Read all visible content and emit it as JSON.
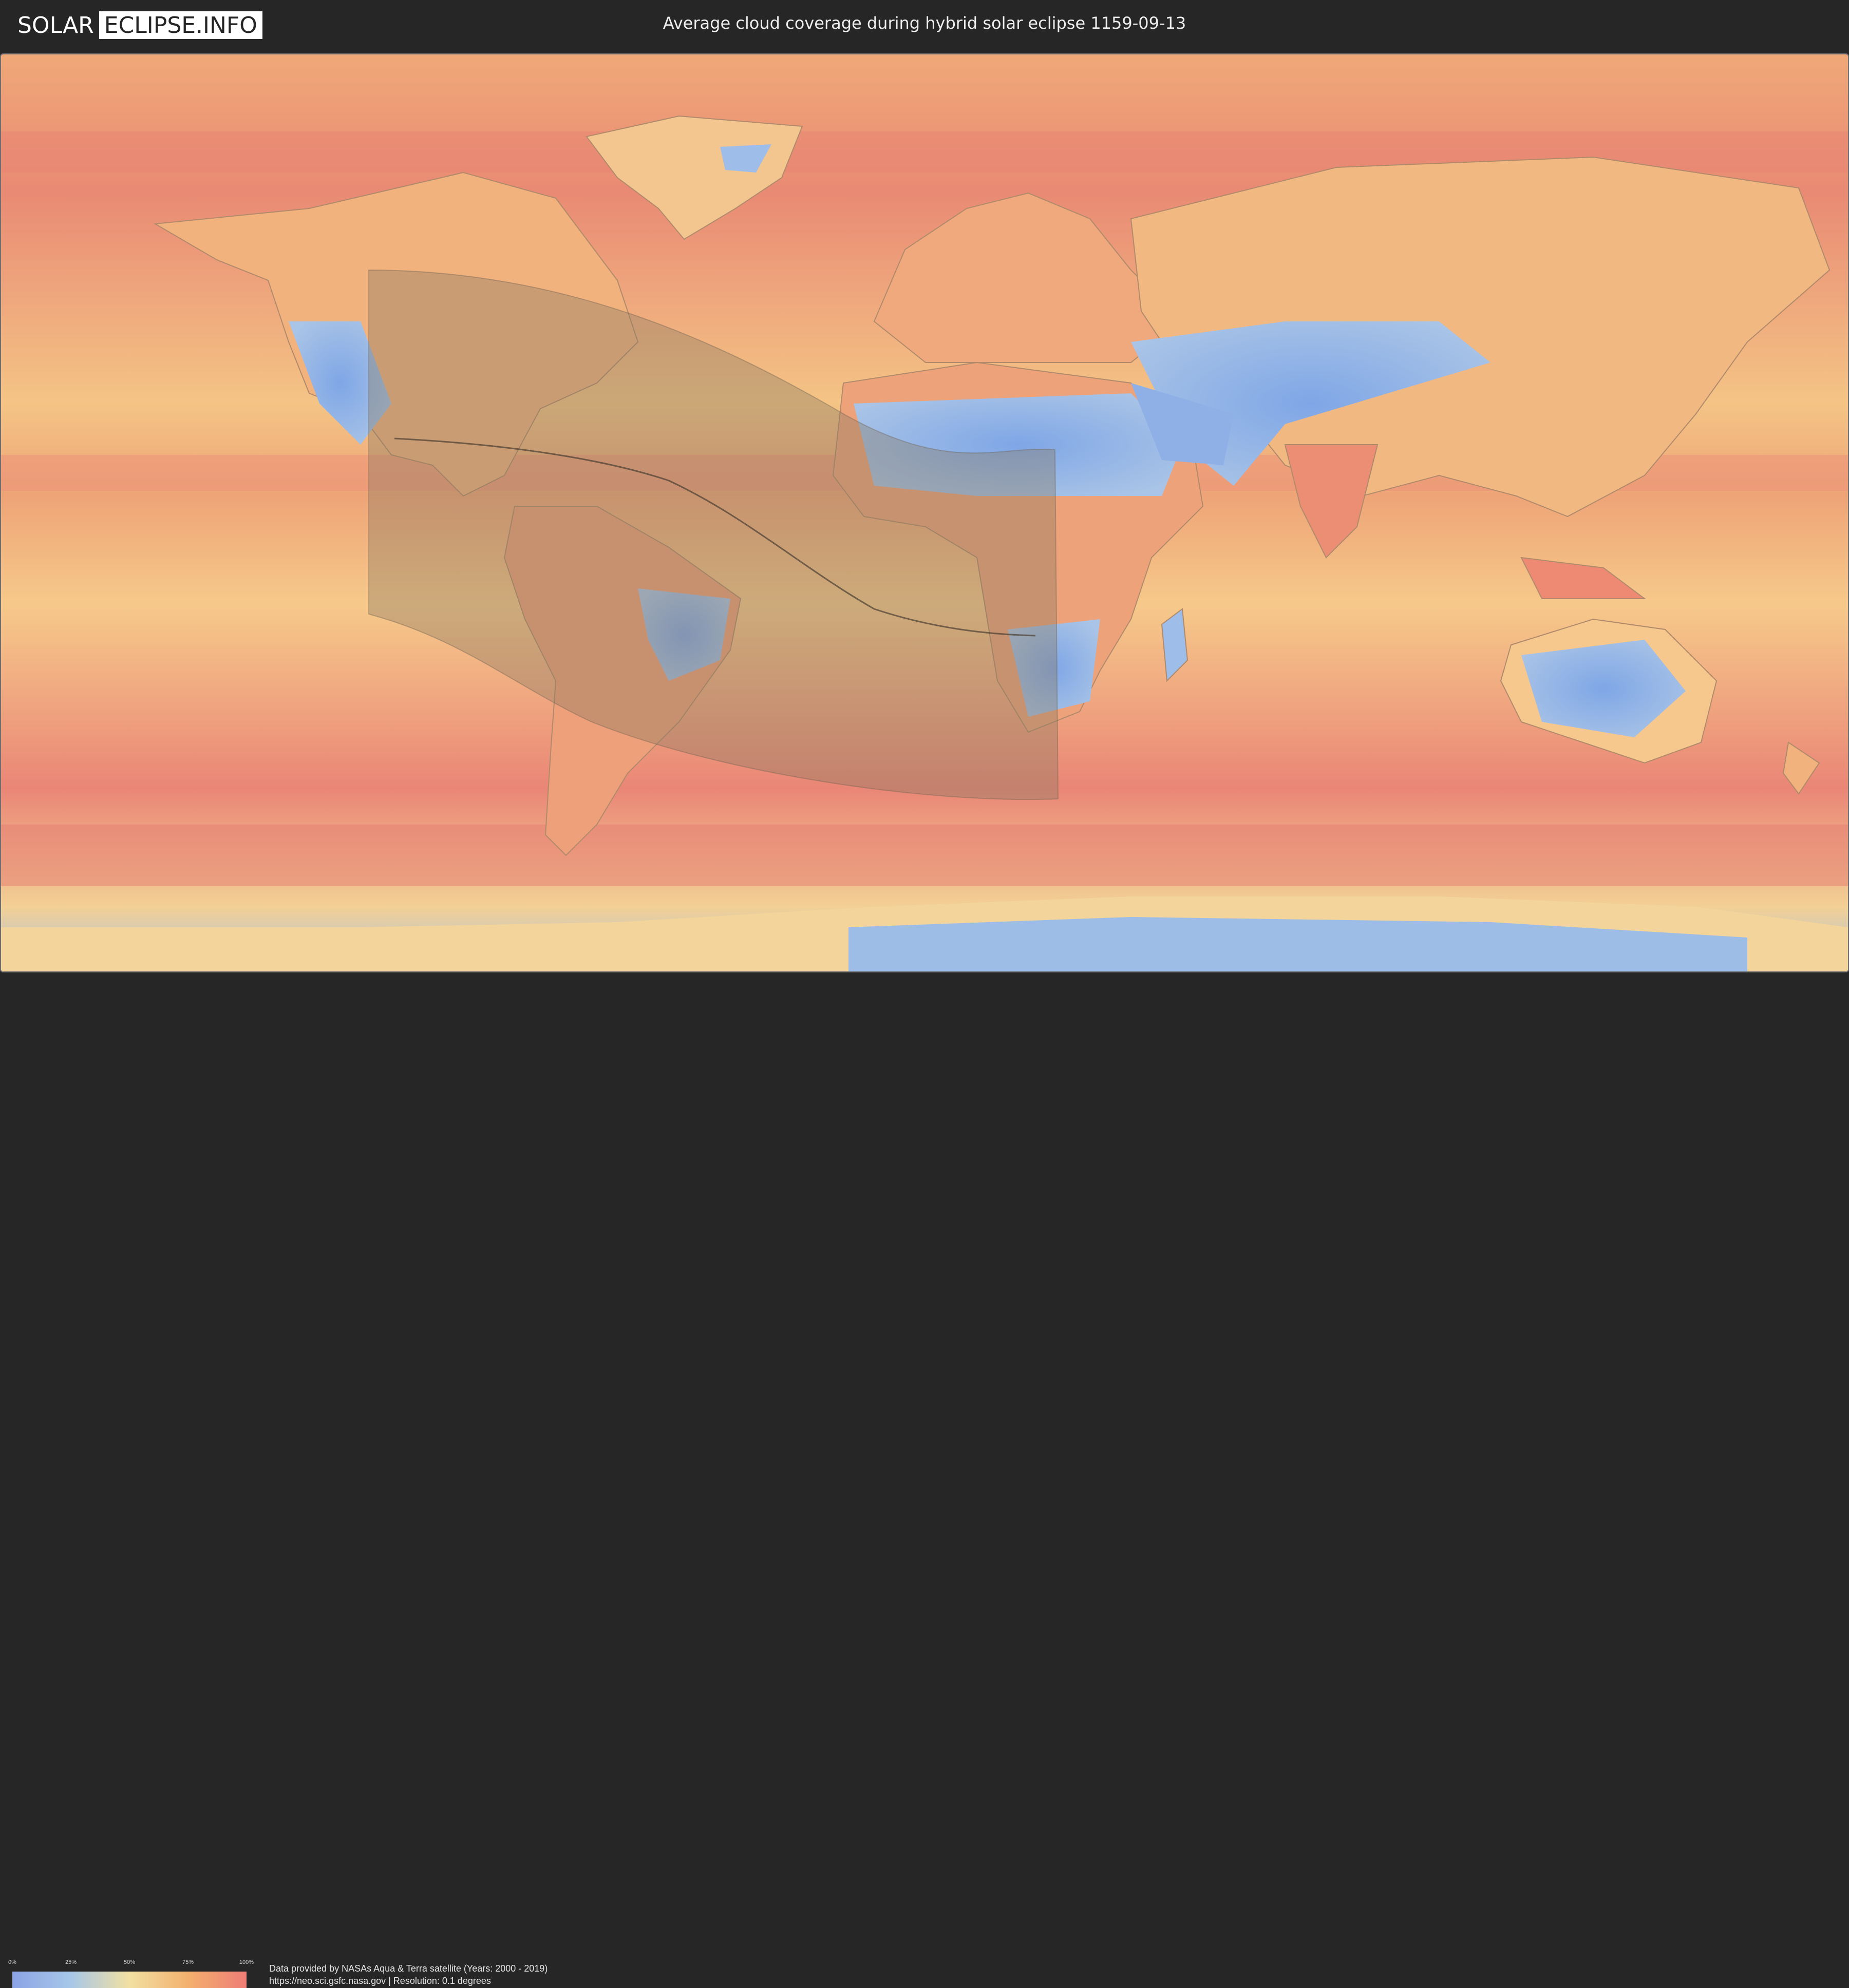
{
  "header": {
    "logo_left": "SOLAR",
    "logo_right": "ECLIPSE.INFO",
    "title": "Average cloud coverage during hybrid solar eclipse 1159-09-13"
  },
  "legend": {
    "ticks": [
      "0%",
      "25%",
      "50%",
      "75%",
      "100%"
    ],
    "colors": [
      "#8aa4e6",
      "#a7c7e8",
      "#f2e0a2",
      "#f4b06e",
      "#ee7d76"
    ]
  },
  "footer": {
    "line1": "Data provided by NASAs Aqua & Terra satellite (Years: 2000 - 2019)",
    "line2": "https://neo.sci.gsfc.nasa.gov | Resolution: 0.1 degrees"
  },
  "map": {
    "ocean_color": "#f2a070",
    "land_clear_color": "#8ab0e8",
    "eclipse_shade_color": "#8a7a62"
  }
}
